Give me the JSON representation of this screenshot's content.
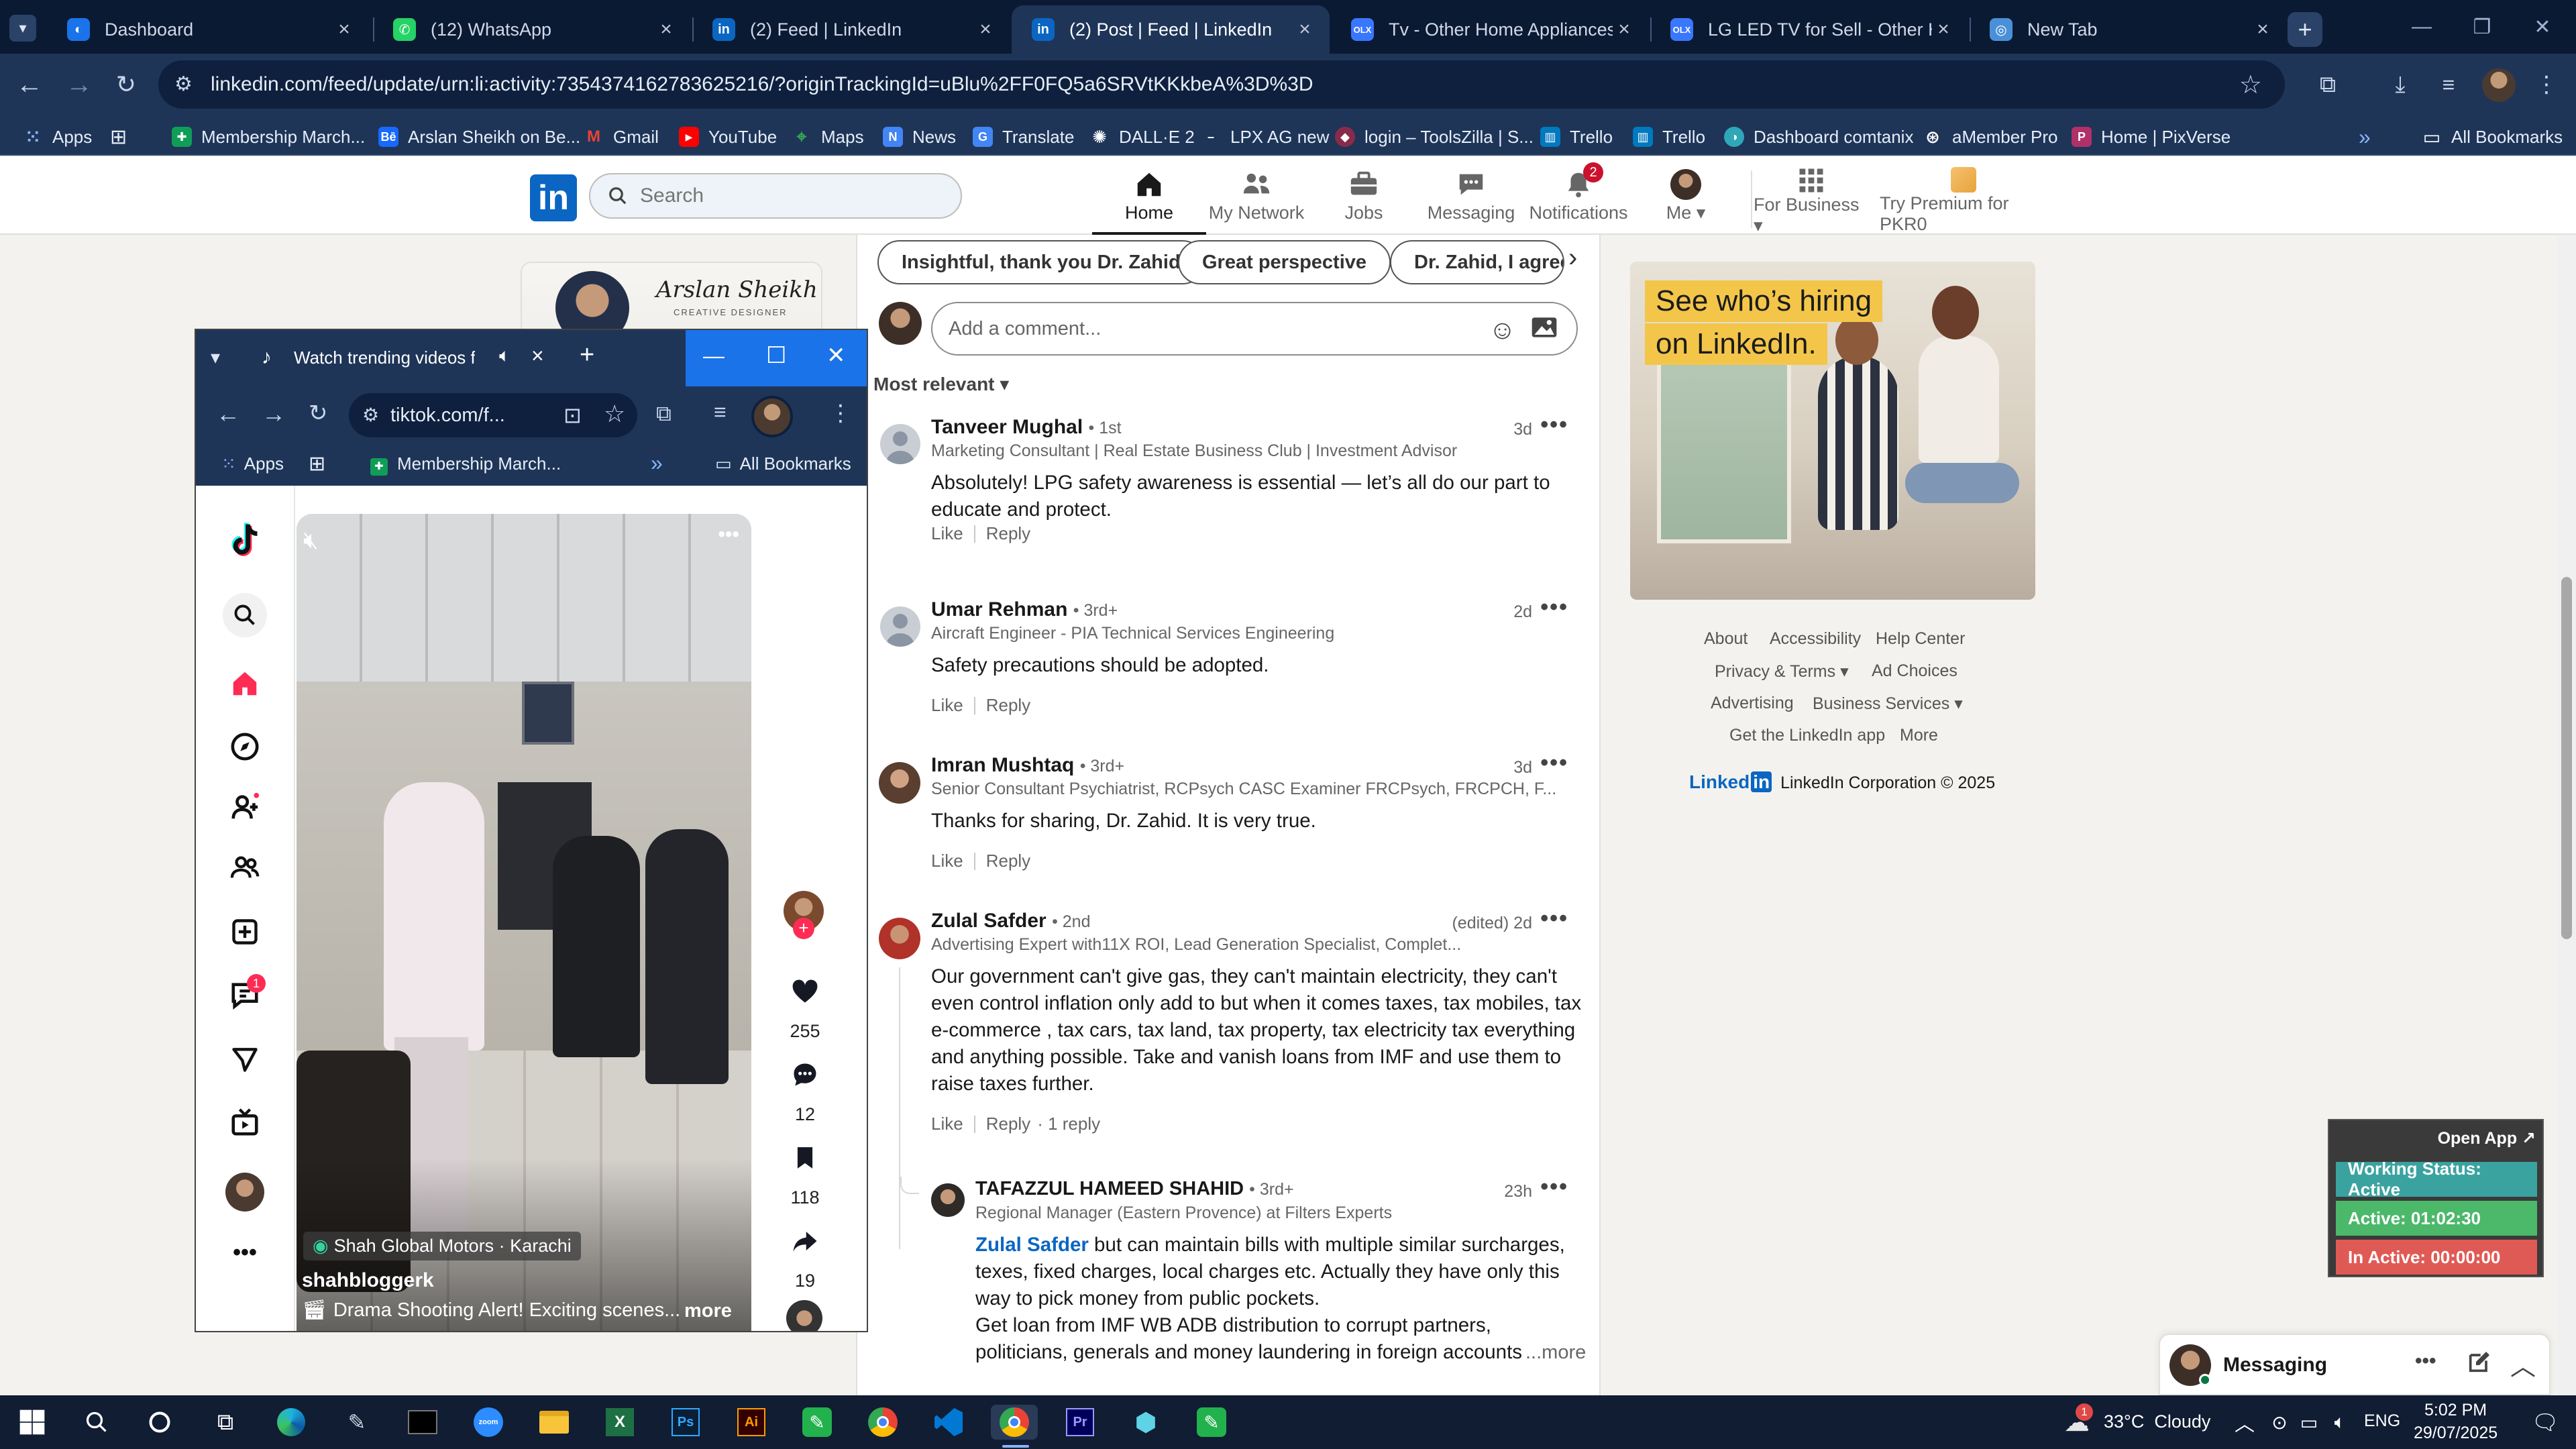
{
  "browser": {
    "tabs": [
      {
        "label": "Dashboard",
        "favicon_color": "#1a73e8",
        "glyph": "◐"
      },
      {
        "label": "(12) WhatsApp",
        "favicon_color": "#25d366",
        "glyph": "✆"
      },
      {
        "label": "(2) Feed | LinkedIn",
        "favicon_color": "#0a66c2",
        "glyph": "in"
      },
      {
        "label": "(2) Post | Feed | LinkedIn",
        "favicon_color": "#0a66c2",
        "glyph": "in",
        "active": true
      },
      {
        "label": "Tv - Other Home Appliances fo",
        "favicon_color": "#3a77ff",
        "glyph": "OLX"
      },
      {
        "label": "LG LED TV for Sell - Other Hom",
        "favicon_color": "#3a77ff",
        "glyph": "OLX"
      },
      {
        "label": "New Tab",
        "favicon_color": "#4a90d9",
        "glyph": "◎"
      }
    ],
    "url": "linkedin.com/feed/update/urn:li:activity:7354374162783625216/?originTrackingId=uBlu%2FF0FQ5a6SRVtKKkbeA%3D%3D",
    "bookmarks": [
      "Apps",
      "Membership March...",
      "Arslan Sheikh on Be...",
      "Gmail",
      "YouTube",
      "Maps",
      "News",
      "Translate",
      "DALL·E 2",
      "LPX AG new",
      "login – ToolsZilla | S...",
      "Trello",
      "Trello",
      "Dashboard comtanix",
      "aMember Pro",
      "Home | PixVerse"
    ],
    "all_bookmarks": "All Bookmarks",
    "overflow": "»"
  },
  "linkedin": {
    "search_placeholder": "Search",
    "nav": [
      {
        "label": "Home"
      },
      {
        "label": "My Network"
      },
      {
        "label": "Jobs"
      },
      {
        "label": "Messaging"
      },
      {
        "label": "Notifications",
        "badge": "2"
      },
      {
        "label": "Me ▾"
      },
      {
        "label": "For Business ▾"
      },
      {
        "label": "Try Premium for PKR0"
      }
    ],
    "profile_card": {
      "name_script": "Arslan Sheikh",
      "subtitle": "CREATIVE DESIGNER"
    }
  },
  "feed": {
    "chips": [
      "Insightful, thank you Dr. Zahid",
      "Great perspective",
      "Dr. Zahid, I agree"
    ],
    "comment_placeholder": "Add a comment...",
    "sort_label": "Most relevant ▾",
    "like": "Like",
    "reply": "Reply",
    "comments": [
      {
        "name": "Tanveer Mughal",
        "degree": "• 1st",
        "headline": "Marketing Consultant | Real Estate Business Club | Investment Advisor",
        "time": "3d",
        "text": "Absolutely! LPG safety awareness is essential — let’s all do our part to educate and protect."
      },
      {
        "name": "Umar Rehman",
        "degree": "• 3rd+",
        "headline": "Aircraft Engineer - PIA Technical Services Engineering",
        "time": "2d",
        "text": "Safety precautions should be adopted."
      },
      {
        "name": "Imran Mushtaq",
        "degree": "• 3rd+",
        "headline": "Senior Consultant Psychiatrist, RCPsych CASC Examiner FRCPsych, FRCPCH, F...",
        "time": "3d",
        "text": "Thanks for sharing, Dr. Zahid. It is very true."
      },
      {
        "name": "Zulal Safder",
        "degree": "• 2nd",
        "headline": "Advertising Expert with11X ROI, Lead Generation Specialist, Complet...",
        "time": "(edited) 2d",
        "text": "Our government can't give gas, they can't maintain electricity, they can't even control inflation only add to but when it comes taxes, tax mobiles, tax e-commerce , tax cars, tax land, tax property, tax electricity tax everything and anything possible. Take and vanish loans from IMF and use them to raise taxes further.",
        "replies": "· 1 reply"
      }
    ],
    "reply_comment": {
      "name": "TAFAZZUL HAMEED SHAHID",
      "degree": "• 3rd+",
      "headline": "Regional Manager (Eastern Provence) at Filters Experts",
      "time": "23h",
      "mention": "Zulal Safder",
      "text": " but can maintain bills with multiple similar surcharges, texes, fixed charges, local charges etc. Actually they have only this way to pick money from public pockets.",
      "text2": "Get loan from IMF WB ADB distribution to corrupt partners, politicians, generals and money laundering in foreign accounts. Public will pa",
      "more": "...more"
    }
  },
  "right_rail": {
    "ad_line1": "See who’s hiring",
    "ad_line2": "on LinkedIn.",
    "footer": {
      "about": "About",
      "accessibility": "Accessibility",
      "help": "Help Center",
      "privacy": "Privacy & Terms ▾",
      "ad_choices": "Ad Choices",
      "advertising": "Advertising",
      "business": "Business Services ▾",
      "get_app": "Get the LinkedIn app",
      "more": "More",
      "brand": "LinkedIn Corporation © 2025"
    }
  },
  "pip": {
    "title": "Watch trending videos for y",
    "url": "tiktok.com/f...",
    "bookmarks": {
      "apps": "Apps",
      "membership": "Membership March...",
      "overflow": "»",
      "all": "All Bookmarks"
    },
    "messages_badge": "1",
    "video": {
      "location": "Shah Global Motors · Karachi",
      "username": "shahbloggerk",
      "caption": "Drama Shooting Alert! Exciting scenes...",
      "more": "more"
    },
    "actions": {
      "likes": "255",
      "comments": "12",
      "saves": "118",
      "shares": "19"
    }
  },
  "status_widget": {
    "open_app": "Open App ↗",
    "working": "Working Status: Active",
    "active": "Active: 01:02:30",
    "inactive": "In Active: 00:00:00",
    "colors": {
      "working": "#3aa3a0",
      "active": "#4cb86a",
      "inactive": "#e05a55"
    }
  },
  "messaging": {
    "label": "Messaging"
  },
  "taskbar": {
    "weather": "33°C  Cloudy",
    "weather_badge": "1",
    "lang": "ENG",
    "time": "5:02 PM",
    "date": "29/07/2025"
  }
}
